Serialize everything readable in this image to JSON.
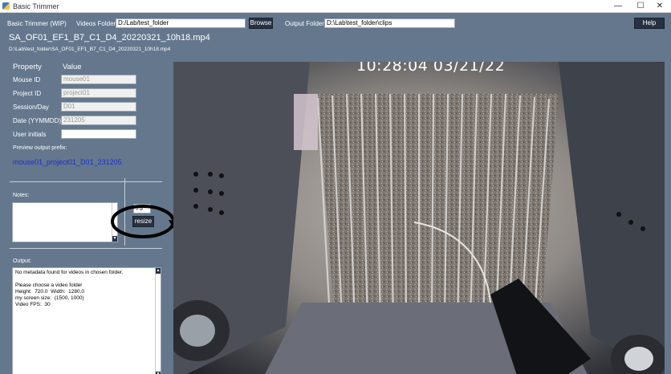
{
  "window": {
    "title": "Basic Trimmer",
    "minimize_glyph": "—",
    "maximize_glyph": "☐",
    "close_glyph": "✕"
  },
  "toolbar": {
    "app_label": "Basic Trimmer (WIP)",
    "videos_folder_label": "Videos Folder:",
    "videos_folder_value": "D:/Lab/test_folder",
    "browse_label": "Browse",
    "output_folder_label": "Output Folder:",
    "output_folder_value": "D:\\Lab\\test_folder\\clips",
    "help_label": "Help"
  },
  "file": {
    "name": "SA_OF01_EF1_B7_C1_D4_20220321_10h18.mp4",
    "path": "D:\\Lab\\test_folder\\SA_OF01_EF1_B7_C1_D4_20220321_10h18.mp4"
  },
  "properties": {
    "header_property": "Property",
    "header_value": "Value",
    "rows": [
      {
        "label": "Mouse ID",
        "value": "mouse01"
      },
      {
        "label": "Project ID",
        "value": "project01"
      },
      {
        "label": "Session/Day",
        "value": "D01"
      },
      {
        "label": "Date (YYMMDD)",
        "value": "231205"
      },
      {
        "label": "User initials",
        "value": ""
      }
    ],
    "preview_label": "Preview output prefix:",
    "preview_value": "mouse01_project01_D01_231205"
  },
  "notes": {
    "label": "Notes:",
    "value": ""
  },
  "resize": {
    "value": "75",
    "button_label": "resize"
  },
  "output": {
    "label": "Output:",
    "lines": "No metadata found for videos in chosen folder.\n\nPlease choose a video folder\nHeight:  720.0  Width:  1280.0\nmy screen size:  (1500, 1000)\nVideo FPS:  30"
  },
  "video": {
    "timestamp": "10:28:04  03/21/22"
  },
  "colors": {
    "app_background": "#64778d",
    "button_background": "#283141",
    "preview_text": "#1f2fd0",
    "annotation": "#000000"
  },
  "icons": {
    "scroll_up": "▲",
    "scroll_down": "▼"
  }
}
